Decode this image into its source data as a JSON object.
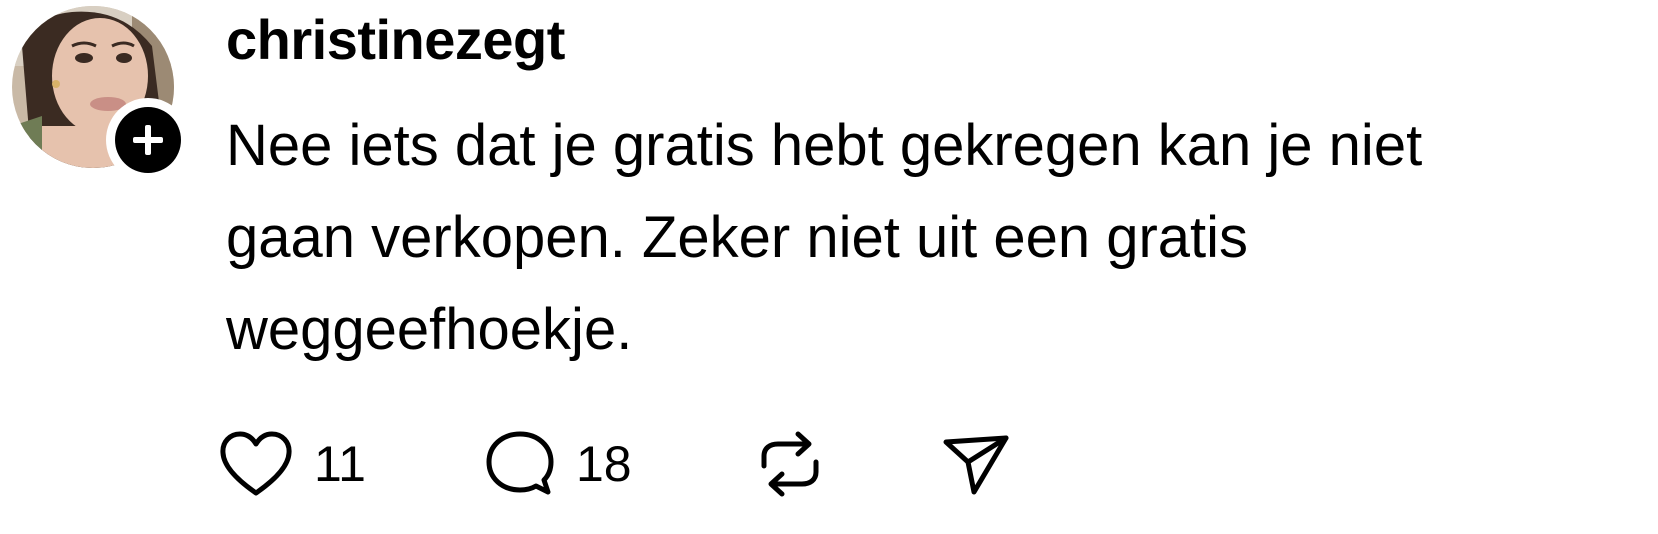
{
  "post": {
    "username": "christinezegt",
    "text_lines": [
      "Nee iets dat je gratis hebt gekregen kan je niet",
      "gaan verkopen. Zeker niet uit een gratis",
      "weggeefhoekje."
    ],
    "follow_icon": "plus-icon",
    "avatar_icon": "profile-photo"
  },
  "actions": {
    "like": {
      "icon": "heart-icon",
      "count": "11"
    },
    "reply": {
      "icon": "speech-bubble-icon",
      "count": "18"
    },
    "repost": {
      "icon": "repost-icon"
    },
    "share": {
      "icon": "send-icon"
    }
  },
  "colors": {
    "text": "#000000",
    "background": "#ffffff"
  }
}
